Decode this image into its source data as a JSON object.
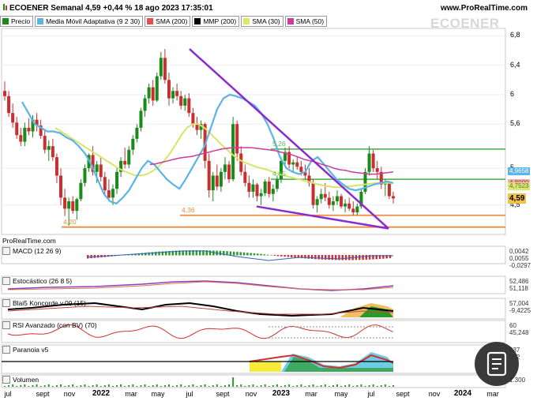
{
  "header": {
    "title": "ECOENER Semanal 4,59 +0,44 % 18 ago 2023 17:35:01",
    "site": "www.ProRealTime.com",
    "watermark": "ECOENER",
    "prorealtime_tag": "ProRealTime.com"
  },
  "legend": [
    {
      "label": "Precio",
      "color": "#1a8a1a"
    },
    {
      "label": "Media Móvil Adaptativa (9 2 30)",
      "color": "#5ab4e6"
    },
    {
      "label": "SMA (200)",
      "color": "#e05050"
    },
    {
      "label": "MMP (200)",
      "color": "#000000"
    },
    {
      "label": "SMA (30)",
      "color": "#dbe86a"
    },
    {
      "label": "SMA (50)",
      "color": "#cc3aa0"
    }
  ],
  "chart_data": {
    "type": "candlestick",
    "y_axis": {
      "ticks": [
        "6,8",
        "6,4",
        "6",
        "5,6",
        "5",
        "4,5"
      ],
      "min": 4.1,
      "max": 6.9
    },
    "x_axis": {
      "labels": [
        "jul",
        "sept",
        "nov",
        "2022",
        "mar",
        "may",
        "jul",
        "sept",
        "nov",
        "2023",
        "mar",
        "may",
        "jul",
        "sept",
        "nov",
        "2024",
        "mar"
      ]
    },
    "last_price": "4,59",
    "price_boxes": [
      "4,9658",
      "4,8000",
      "4,7523"
    ],
    "levels": [
      {
        "label": "5,26",
        "value": 5.26,
        "color": "#5cb85c"
      },
      {
        "label": "4,85",
        "value": 4.85,
        "color": "#5cb85c"
      },
      {
        "label": "4,36",
        "value": 4.36,
        "color": "#f08a3c"
      },
      {
        "label": "4,20",
        "value": 4.2,
        "color": "#f08a3c"
      }
    ],
    "candles": [
      [
        6.05,
        6.18,
        5.92,
        5.98
      ],
      [
        5.98,
        6.05,
        5.7,
        5.75
      ],
      [
        5.75,
        5.88,
        5.55,
        5.62
      ],
      [
        5.62,
        5.7,
        5.4,
        5.45
      ],
      [
        5.45,
        5.55,
        5.3,
        5.36
      ],
      [
        5.36,
        5.62,
        5.3,
        5.55
      ],
      [
        5.55,
        5.68,
        5.45,
        5.5
      ],
      [
        5.5,
        5.72,
        5.42,
        5.66
      ],
      [
        5.66,
        5.75,
        5.5,
        5.58
      ],
      [
        5.58,
        5.66,
        5.4,
        5.44
      ],
      [
        5.44,
        5.52,
        5.2,
        5.25
      ],
      [
        5.25,
        5.38,
        5.1,
        5.3
      ],
      [
        5.3,
        5.4,
        5.1,
        5.15
      ],
      [
        5.15,
        5.2,
        4.8,
        4.9
      ],
      [
        4.9,
        5.0,
        4.5,
        4.6
      ],
      [
        4.6,
        4.72,
        4.35,
        4.45
      ],
      [
        4.45,
        4.6,
        4.22,
        4.55
      ],
      [
        4.55,
        4.62,
        4.38,
        4.42
      ],
      [
        4.42,
        4.6,
        4.3,
        4.58
      ],
      [
        4.58,
        4.85,
        4.55,
        4.8
      ],
      [
        4.8,
        5.05,
        4.75,
        5.0
      ],
      [
        5.0,
        5.2,
        4.95,
        5.18
      ],
      [
        5.18,
        5.3,
        4.9,
        4.95
      ],
      [
        4.95,
        5.1,
        4.8,
        5.05
      ],
      [
        5.05,
        5.15,
        4.82,
        4.88
      ],
      [
        4.88,
        4.95,
        4.62,
        4.7
      ],
      [
        4.7,
        4.85,
        4.55,
        4.6
      ],
      [
        4.6,
        4.78,
        4.5,
        4.72
      ],
      [
        4.72,
        5.0,
        4.65,
        4.95
      ],
      [
        4.95,
        5.15,
        4.88,
        5.1
      ],
      [
        5.1,
        5.28,
        5.0,
        5.05
      ],
      [
        5.05,
        5.3,
        5.0,
        5.25
      ],
      [
        5.25,
        5.45,
        5.18,
        5.4
      ],
      [
        5.4,
        5.6,
        5.35,
        5.55
      ],
      [
        5.55,
        5.82,
        5.5,
        5.78
      ],
      [
        5.78,
        6.0,
        5.7,
        5.95
      ],
      [
        5.95,
        6.15,
        5.88,
        6.1
      ],
      [
        6.1,
        6.2,
        5.85,
        5.92
      ],
      [
        5.92,
        6.3,
        5.9,
        6.25
      ],
      [
        6.25,
        6.58,
        6.2,
        6.5
      ],
      [
        6.5,
        6.62,
        6.15,
        6.2
      ],
      [
        6.2,
        6.3,
        5.85,
        5.95
      ],
      [
        5.95,
        6.1,
        5.88,
        6.05
      ],
      [
        6.05,
        6.15,
        5.92,
        5.98
      ],
      [
        5.98,
        6.05,
        5.8,
        5.85
      ],
      [
        5.85,
        6.0,
        5.78,
        5.95
      ],
      [
        5.95,
        6.02,
        5.7,
        5.75
      ],
      [
        5.75,
        5.82,
        5.55,
        5.6
      ],
      [
        5.6,
        5.7,
        5.45,
        5.52
      ],
      [
        5.52,
        5.65,
        5.4,
        5.6
      ],
      [
        5.6,
        5.62,
        5.0,
        5.1
      ],
      [
        5.1,
        5.2,
        4.6,
        4.7
      ],
      [
        4.7,
        4.95,
        4.55,
        4.9
      ],
      [
        4.9,
        5.05,
        4.7,
        4.75
      ],
      [
        4.75,
        5.0,
        4.68,
        4.95
      ],
      [
        4.95,
        5.15,
        4.85,
        5.05
      ],
      [
        5.05,
        5.1,
        4.8,
        4.85
      ],
      [
        4.85,
        5.7,
        4.82,
        5.6
      ],
      [
        5.6,
        5.65,
        5.1,
        5.2
      ],
      [
        5.2,
        5.3,
        4.9,
        4.95
      ],
      [
        4.95,
        5.05,
        4.75,
        4.8
      ],
      [
        4.8,
        4.9,
        4.6,
        4.68
      ],
      [
        4.68,
        4.85,
        4.6,
        4.78
      ],
      [
        4.78,
        4.8,
        4.55,
        4.62
      ],
      [
        4.62,
        4.72,
        4.5,
        4.66
      ],
      [
        4.66,
        4.85,
        4.62,
        4.82
      ],
      [
        4.82,
        4.88,
        4.6,
        4.65
      ],
      [
        4.65,
        4.78,
        4.55,
        4.72
      ],
      [
        4.72,
        4.9,
        4.68,
        4.85
      ],
      [
        4.85,
        5.15,
        4.8,
        5.1
      ],
      [
        5.1,
        5.28,
        5.05,
        5.22
      ],
      [
        5.22,
        5.3,
        5.0,
        5.05
      ],
      [
        5.05,
        5.12,
        4.95,
        5.08
      ],
      [
        5.08,
        5.15,
        4.98,
        5.02
      ],
      [
        5.02,
        5.1,
        4.9,
        4.95
      ],
      [
        4.95,
        5.05,
        4.85,
        4.9
      ],
      [
        4.9,
        5.0,
        4.75,
        4.8
      ],
      [
        4.8,
        4.85,
        4.45,
        4.5
      ],
      [
        4.5,
        4.62,
        4.4,
        4.58
      ],
      [
        4.58,
        4.72,
        4.52,
        4.65
      ],
      [
        4.65,
        4.8,
        4.55,
        4.6
      ],
      [
        4.6,
        4.68,
        4.45,
        4.5
      ],
      [
        4.5,
        4.62,
        4.42,
        4.55
      ],
      [
        4.55,
        4.7,
        4.5,
        4.62
      ],
      [
        4.62,
        4.65,
        4.45,
        4.48
      ],
      [
        4.48,
        4.58,
        4.4,
        4.52
      ],
      [
        4.52,
        4.6,
        4.42,
        4.45
      ],
      [
        4.45,
        4.55,
        4.36,
        4.4
      ],
      [
        4.4,
        4.52,
        4.36,
        4.48
      ],
      [
        4.48,
        4.72,
        4.45,
        4.68
      ],
      [
        4.68,
        5.0,
        4.65,
        4.95
      ],
      [
        4.95,
        5.3,
        4.9,
        5.2
      ],
      [
        5.2,
        5.25,
        4.95,
        5.0
      ],
      [
        5.0,
        5.1,
        4.85,
        4.95
      ],
      [
        4.95,
        5.02,
        4.72,
        4.78
      ],
      [
        4.78,
        4.85,
        4.62,
        4.8
      ],
      [
        4.8,
        4.82,
        4.58,
        4.62
      ],
      [
        4.62,
        4.68,
        4.52,
        4.59
      ]
    ],
    "sma30": [
      5.55,
      5.5,
      5.45,
      5.4,
      5.35,
      5.3,
      5.25,
      5.2,
      5.15,
      5.1,
      5.05,
      5.0,
      4.96,
      4.93,
      4.9,
      4.9,
      4.92,
      4.96,
      5.02,
      5.1,
      5.2,
      5.32,
      5.45,
      5.55,
      5.6,
      5.6,
      5.55,
      5.48,
      5.4,
      5.32,
      5.25,
      5.18,
      5.12,
      5.08,
      5.05,
      5.02,
      5.0,
      4.98,
      4.95,
      4.92,
      4.9,
      4.88,
      4.86,
      4.84,
      4.82,
      4.8,
      4.78,
      4.76,
      4.75,
      4.74,
      4.74,
      4.75,
      4.76,
      4.77,
      4.78,
      4.79,
      4.8,
      4.8,
      4.8,
      4.8
    ],
    "ama": [
      5.9,
      5.75,
      5.6,
      5.55,
      5.5,
      5.5,
      5.48,
      5.42,
      5.38,
      5.3,
      5.2,
      5.05,
      4.85,
      4.65,
      4.55,
      4.52,
      4.6,
      4.7,
      4.85,
      5.0,
      5.1,
      5.05,
      4.95,
      4.85,
      4.78,
      4.72,
      4.85,
      5.0,
      5.15,
      5.3,
      5.55,
      5.8,
      5.95,
      6.0,
      5.98,
      5.95,
      5.9,
      5.85,
      5.75,
      5.6,
      5.4,
      5.15,
      5.0,
      4.95,
      4.92,
      4.95,
      5.1,
      5.15,
      5.05,
      4.95,
      4.85,
      4.78,
      4.72,
      4.7,
      4.72,
      4.75,
      4.78,
      4.8,
      4.82,
      4.8
    ],
    "sma50": [
      5.05,
      5.06,
      5.08,
      5.1,
      5.12,
      5.14,
      5.15,
      5.16,
      5.18,
      5.2,
      5.22,
      5.24,
      5.26,
      5.27,
      5.28,
      5.28,
      5.28,
      5.28,
      5.27,
      5.26,
      5.25,
      5.24,
      5.22,
      5.2,
      5.18,
      5.15,
      5.12,
      5.1,
      5.08,
      5.05,
      5.03,
      5.0,
      4.98,
      4.97,
      4.95,
      4.94,
      4.93,
      4.92,
      4.92,
      4.93,
      4.94,
      4.95
    ]
  },
  "panels": [
    {
      "key": "macd",
      "title": "MACD (12 26 9)",
      "values": [
        "0,0042",
        "0,0055",
        "-0,0297"
      ]
    },
    {
      "key": "esto",
      "title": "Estocástico (26 8 5)",
      "values": [
        "52,486",
        "51,118"
      ]
    },
    {
      "key": "blai",
      "title": "Blai5 Koncorde v.09 (15)",
      "values": [
        "57,004",
        "-9,4225"
      ]
    },
    {
      "key": "rsi",
      "title": "RSI Avanzado (con BV) (70)",
      "values": [
        "60",
        "45,248"
      ]
    },
    {
      "key": "para",
      "title": "Paranoia v5",
      "values": [
        "037",
        "052"
      ]
    },
    {
      "key": "vol",
      "title": "Volumen",
      "values": [
        "1.300"
      ]
    }
  ],
  "price_tags": {
    "last": "4,59",
    "p1": "4,9658",
    "p2": "4,8000",
    "p3": "4,7523"
  }
}
